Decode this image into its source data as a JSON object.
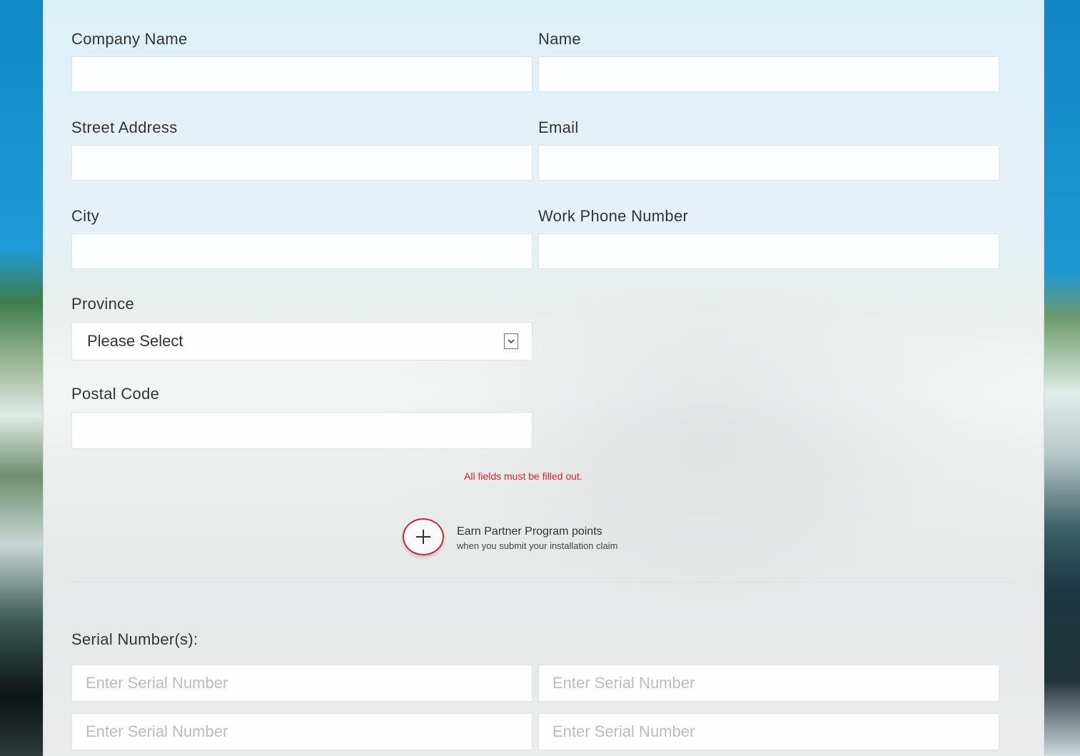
{
  "form": {
    "company_name_label": "Company Name",
    "name_label": "Name",
    "street_address_label": "Street Address",
    "email_label": "Email",
    "city_label": "City",
    "work_phone_label": "Work Phone Number",
    "province_label": "Province",
    "province_selected": "Please Select",
    "postal_code_label": "Postal Code",
    "validation_message": "All fields must be filled out.",
    "accent_color": "#e4202b"
  },
  "promo": {
    "icon": "plus-icon",
    "title": "Earn Partner Program points",
    "subtitle": "when you submit your installation claim"
  },
  "serials": {
    "label": "Serial Number(s):",
    "placeholder": "Enter Serial Number"
  }
}
